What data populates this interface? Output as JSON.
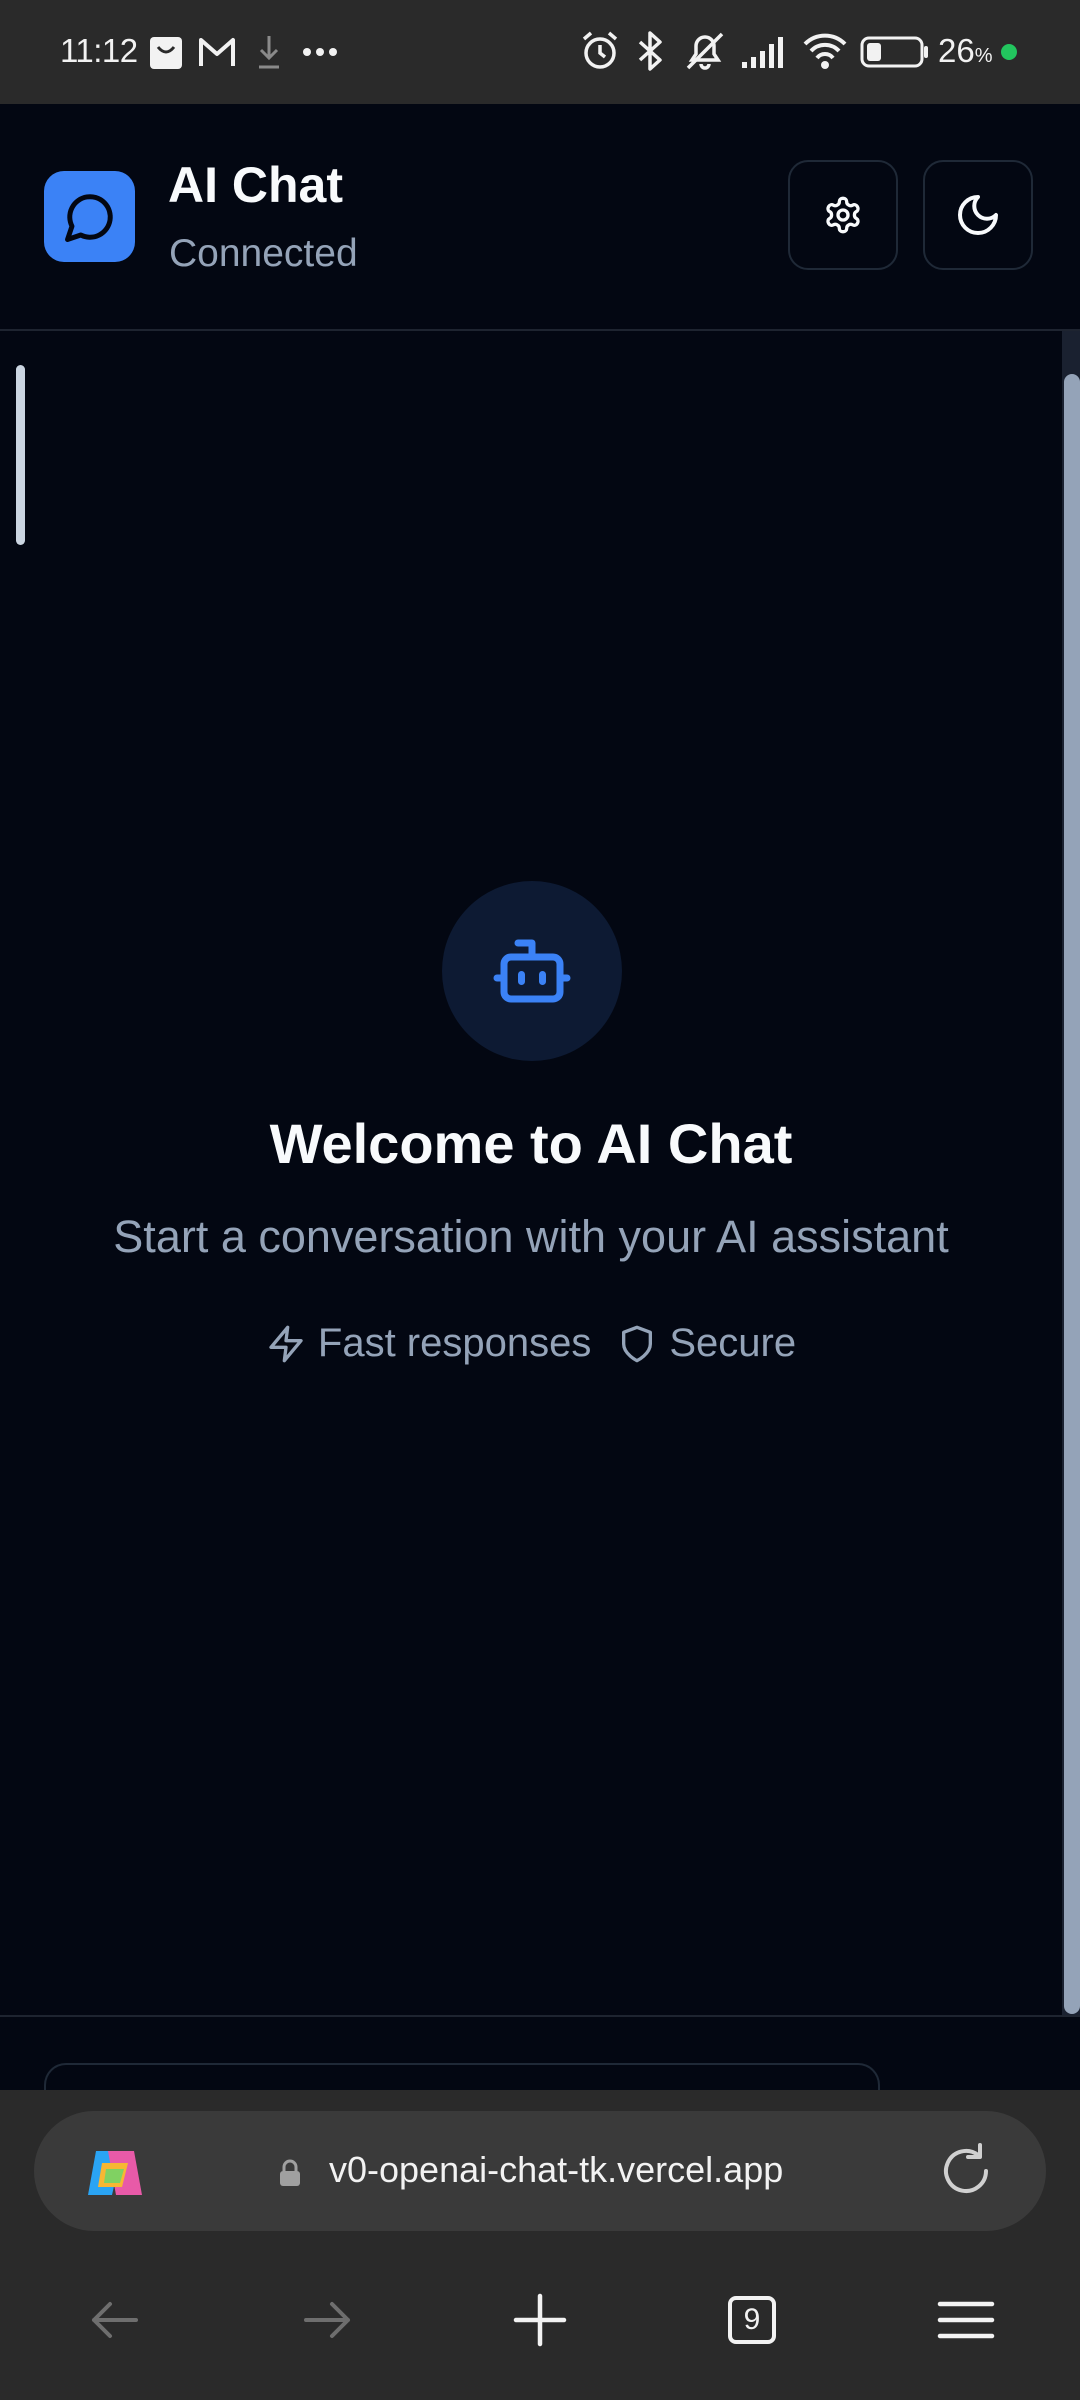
{
  "status_bar": {
    "time": "11:12",
    "battery_percent": "26",
    "battery_unit": "%",
    "icons": [
      "shopping-bag-icon",
      "gmail-icon",
      "download-icon",
      "more-dots-icon",
      "alarm-icon",
      "bluetooth-icon",
      "mute-icon",
      "signal-icon",
      "wifi-icon",
      "battery-icon"
    ]
  },
  "header": {
    "title": "AI Chat",
    "status": "Connected",
    "settings_icon": "gear-icon",
    "theme_icon": "moon-icon"
  },
  "welcome": {
    "icon": "bot-icon",
    "title": "Welcome to AI Chat",
    "subtitle": "Start a conversation with your AI assistant",
    "features": [
      {
        "icon": "zap-icon",
        "label": "Fast responses"
      },
      {
        "icon": "shield-icon",
        "label": "Secure"
      }
    ]
  },
  "browser": {
    "url": "v0-openai-chat-tk.vercel.app",
    "tab_count": "9"
  },
  "colors": {
    "background": "#030712",
    "accent": "#3b82f6",
    "muted_text": "#94a3b8",
    "online_dot": "#22c55e"
  }
}
